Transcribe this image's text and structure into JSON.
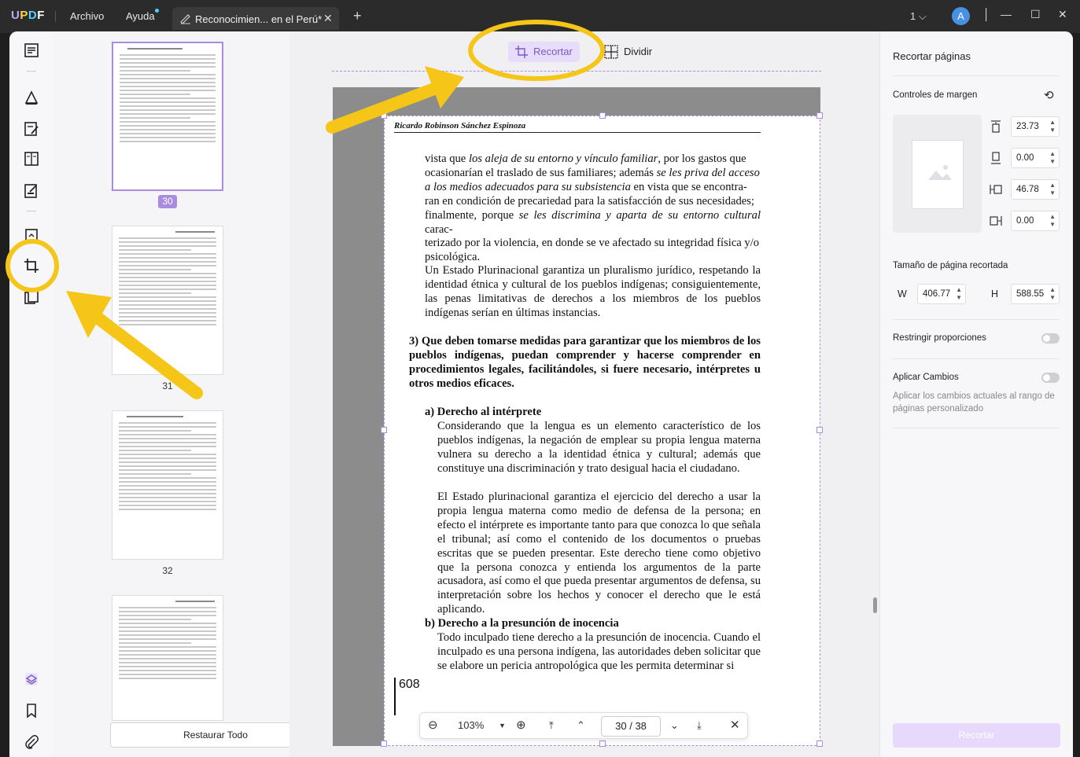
{
  "app": {
    "logo": {
      "u": "U",
      "p": "P",
      "d": "D",
      "f": "F"
    },
    "menu": {
      "file": "Archivo",
      "help": "Ayuda"
    },
    "tab_title": "Reconocimien... en el Perú*",
    "tab_close": "✕",
    "new_tab": "+",
    "page_indicator": "1",
    "avatar_letter": "A",
    "accent_color": "#a98ce0"
  },
  "thumbnails": {
    "pages": [
      {
        "number": "30",
        "active": true
      },
      {
        "number": "31",
        "active": false
      },
      {
        "number": "32",
        "active": false
      },
      {
        "number": "",
        "active": false
      }
    ],
    "restore_label": "Restaurar Todo"
  },
  "toolbar": {
    "crop_label": "Recortar",
    "split_label": "Dividir"
  },
  "document": {
    "running_head": "Ricardo Robinson Sánchez Espinoza",
    "para1_lines": [
      "vista que <i>los aleja de su entorno y vínculo familiar</i>, por los gastos que",
      "ocasionarían el traslado de sus familiares; además <i>se les priva del acceso</i>",
      "<i>a los medios adecuados para su subsistencia</i> en vista que se encontra-",
      "ran en condición de precariedad para la satisfacción de sus necesidades;",
      "finalmente, porque <i>se les discrimina y aparta de su entorno cultural</i> carac-",
      "terizado por la violencia, en donde se ve afectado su integridad física y/o",
      "psicológica."
    ],
    "para2": "Un Estado Plurinacional garantiza un pluralismo jurídico, respetando la identidad étnica y cultural de los pueblos indígenas; consiguientemente, las penas limitativas de derechos a los miembros de los pueblos indígenas serían en últimas instancias.",
    "heading3": "3) Que deben tomarse medidas para garantizar  que los miembros de los pueblos indígenas, puedan comprender y hacerse comprender en procedimientos legales, facilitándoles, si fuere necesario, intérpretes u otros medios eficaces.",
    "heading_a": "a) Derecho al intérprete",
    "para_a1": "Considerando que la lengua es un elemento característico de los pueblos indígenas, la negación de emplear su propia lengua materna vulnera su derecho a la identidad étnica y cultural; además que constituye una discriminación y trato desigual hacia el ciudadano.",
    "para_a2": "El Estado plurinacional garantiza el ejercicio del derecho a usar la propia lengua materna como medio de defensa de la persona; en efecto el intérprete es importante tanto para que conozca lo que señala el tribunal; así como el contenido de los documentos o pruebas escritas que se pueden presentar. Este derecho tiene como objetivo que la persona conozca y entienda los argumentos de la parte acusadora, así como el que pueda presentar argumentos de defensa, su interpretación sobre los hechos y conocer el derecho que le está aplicando.",
    "heading_b": "b) Derecho a la presunción de inocencia",
    "para_b1": "Todo inculpado tiene derecho a la presunción de inocencia. Cuando el inculpado es una persona  indígena, las autoridades deben solicitar que se elabore un pericia antropológica que les permita determinar si",
    "page_number": "608"
  },
  "navbar": {
    "zoom": "103%",
    "current_page": "30",
    "separator": "/",
    "total_pages": "38"
  },
  "right_panel": {
    "title": "Recortar páginas",
    "margin_controls_label": "Controles de margen",
    "margins": {
      "top": "23.73",
      "bottom": "0.00",
      "left": "46.78",
      "right": "0.00"
    },
    "cropped_size_label": "Tamaño de página recortada",
    "w_label": "W",
    "h_label": "H",
    "width": "406.77",
    "height": "588.55",
    "restrict_label": "Restringir proporciones",
    "restrict_on": false,
    "apply_changes_label": "Aplicar Cambios",
    "apply_changes_on": false,
    "apply_desc": "Aplicar los cambios actuales al rango de páginas personalizado",
    "crop_button": "Recortar"
  }
}
